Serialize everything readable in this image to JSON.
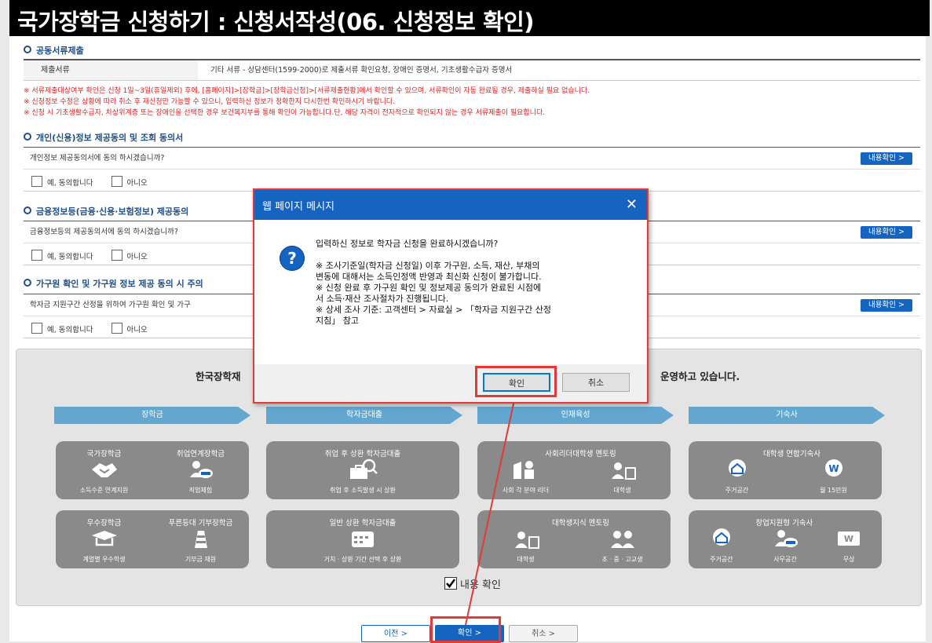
{
  "title": "국가장학금 신청하기 : 신청서작성(06. 신청정보 확인)",
  "section_common": {
    "title": "공동서류제출",
    "th": "제출서류",
    "td": "기타 서류 - 상담센터(1599-2000)로 제출서류 확인요청, 장애인 증명서, 기초생활수급자 증명서"
  },
  "notices": [
    "※ 서류제출대상여부 확인은 신청 1일~3일(휴일제외) 후에, [홈페이지]>[장학금]>[장학금신청]>[서류제출현황]에서 확인할 수 있으며, 서류확인이 자동 완료될 경우, 제출하실 필요 없습니다.",
    "※ 신청정보 수정은 상황에 따라 취소 후 재신청만 가능할 수 있으니, 입력하신 정보가 정확한지 다시한번 확인하시기 바랍니다.",
    "※ 신청 시 기초생활수급자, 차상위계층 또는 장애인을 선택한 경우 보건복지부를 통해 확인이 가능합니다.단, 해당 자격이 전자적으로 확인되지 않는 경우 서류제출이 필요합니다."
  ],
  "consents": [
    {
      "title": "개인(신용)정보 제공동의 및 조회 동의서",
      "question": "개인정보 제공동의서에 동의 하시겠습니까?",
      "detail": "내용확인 >",
      "yes": "예, 동의합니다",
      "no": "아니오"
    },
    {
      "title": "금융정보등(금융·신용·보험정보) 제공동의",
      "question": "금융정보등의 제공동의서에 동의 하시겠습니까?",
      "detail": "내용확인 >",
      "yes": "예, 동의합니다",
      "no": "아니오"
    },
    {
      "title": "가구원 확인 및 가구원 정보 제공 동의 시 주의",
      "question": "학자금 지원구간 산정을 위하여 가구원 확인 및 가구",
      "detail": "내용확인 >",
      "yes": "예, 동의합니다",
      "no": "아니오"
    }
  ],
  "info_box": {
    "text_left": "한국장학재",
    "text_right": "운영하고 있습니다.",
    "categories": [
      "장학금",
      "학자금대출",
      "인재육성",
      "기숙사"
    ],
    "cards_top": [
      {
        "items": [
          {
            "label": "국가장학금",
            "sub": "소득수준 연계지원"
          },
          {
            "label": "취업연계장학금",
            "sub": "직업체험"
          }
        ]
      },
      {
        "items": [
          {
            "label": "취업 후 상환 학자금대출",
            "sub": "취업 후 소득발생 시 상환"
          }
        ]
      },
      {
        "items": [
          {
            "label": "사회리더대학생 멘토링",
            "sub": "사회 각 분야 리더"
          },
          {
            "label": "",
            "sub": "대학생"
          }
        ]
      },
      {
        "items": [
          {
            "label": "대학생 연합기숙사",
            "sub": "주거공간"
          },
          {
            "label": "",
            "sub": "월 15만원"
          }
        ]
      }
    ],
    "cards_bottom": [
      {
        "items": [
          {
            "label": "우수장학금",
            "sub": "계열별 우수학생"
          },
          {
            "label": "푸른등대 기부장학금",
            "sub": "기부금 재원"
          }
        ]
      },
      {
        "items": [
          {
            "label": "일반 상환 학자금대출",
            "sub": "거치 · 상환 기간 선택 후 상환"
          }
        ]
      },
      {
        "items": [
          {
            "label": "대학생지식 멘토링",
            "sub": "대학생"
          },
          {
            "label": "",
            "sub": "초 · 중 · 고교생"
          }
        ]
      },
      {
        "items": [
          {
            "label": "창업지원형 기숙사",
            "sub": "주거공간"
          },
          {
            "label": "",
            "sub": "사무공간"
          },
          {
            "label": "",
            "sub": "무상"
          }
        ]
      }
    ],
    "check_label": "내용 확인"
  },
  "bottom_buttons": {
    "prev": "이전 >",
    "confirm": "확인 >",
    "cancel": "취소 >"
  },
  "dialog": {
    "title": "웹 페이지 메시지",
    "close": "✕",
    "icon": "?",
    "lines": [
      "입력하신 정보로 학자금 신청을 완료하시겠습니까?",
      "",
      " ※ 조사기준일(학자금 신청일) 이후 가구원, 소득, 재산, 부채의",
      "변동에 대해서는 소득인정액 반영과 최신화 신청이 불가합니다.",
      "※ 신청 완료 후 가구원 확인 및 정보제공 동의가 완료된 시점에",
      "서 소득·재산 조사절차가 진행됩니다.",
      "※ 상세 조사 기준: 고객센터 > 자료실 > 「학자금 지원구간 산정",
      "지침」 참고"
    ],
    "ok": "확인",
    "cancel": "취소"
  },
  "colors": {
    "accent": "#1565c0",
    "highlight": "#e53935",
    "notice": "#e02020"
  }
}
